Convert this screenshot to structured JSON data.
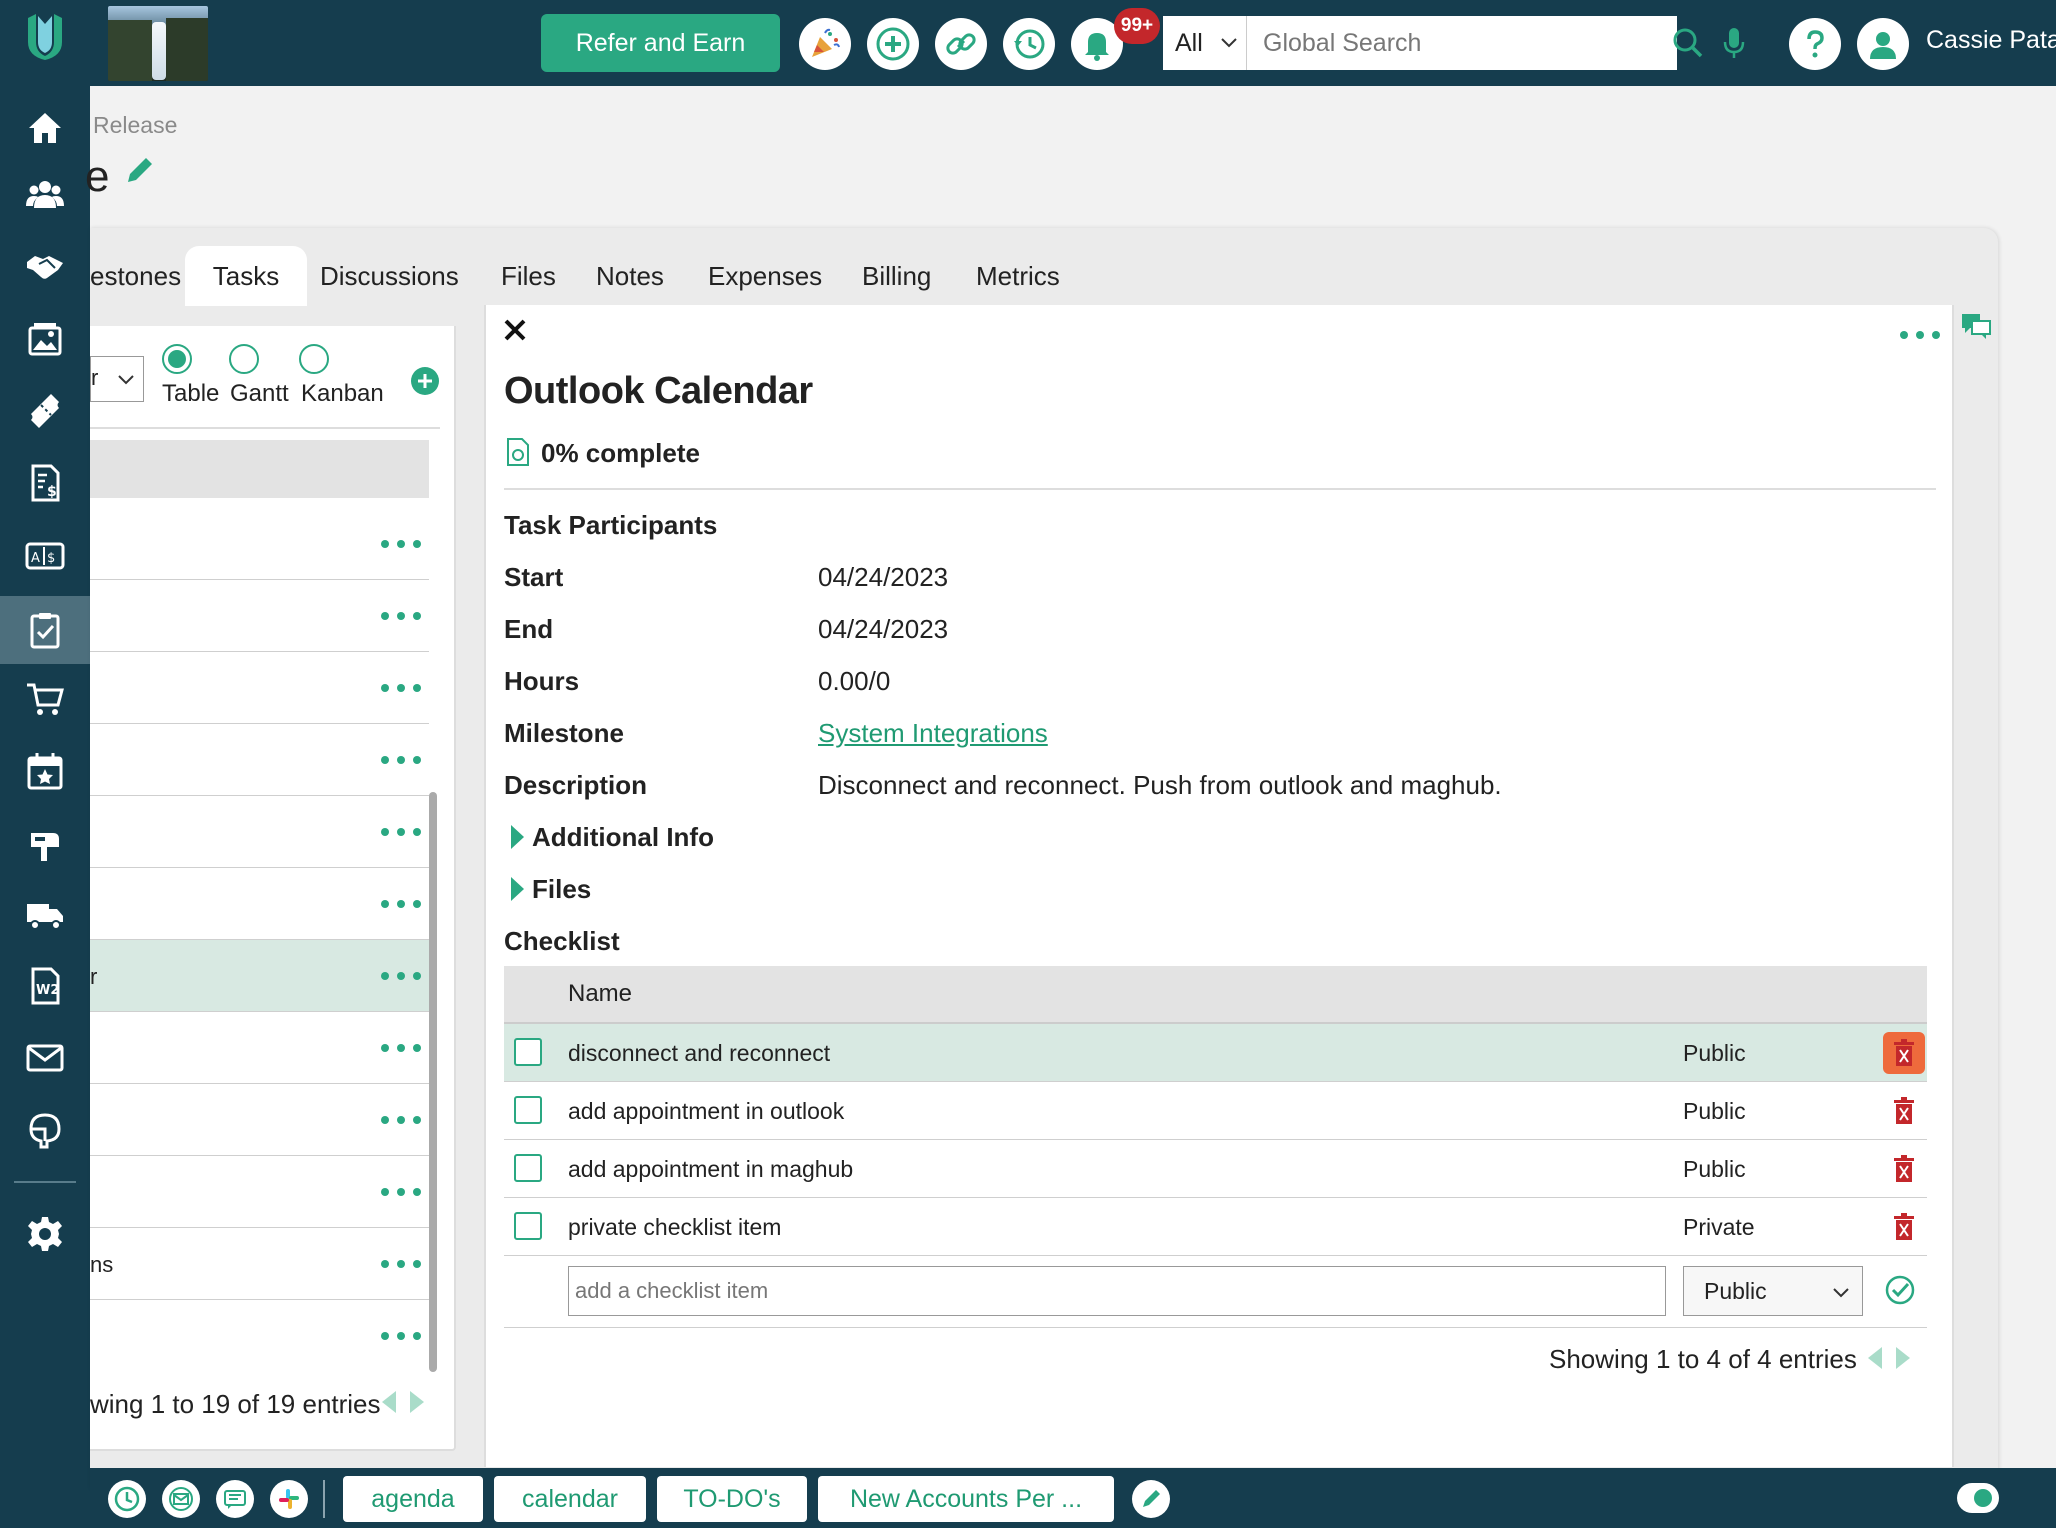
{
  "topbar": {
    "refer_label": "Refer and Earn",
    "notification_count": "99+",
    "search_scope": "All",
    "search_placeholder": "Global Search",
    "user_name": "Cassie Pata"
  },
  "nav": {
    "items": [
      "home-icon",
      "people-icon",
      "handshake-icon",
      "gallery-icon",
      "ticket-icon",
      "invoice-icon",
      "estimates-icon",
      "tasks-icon",
      "cart-icon",
      "calendar-star-icon",
      "mailbox-icon",
      "truck-icon",
      "w2-icon",
      "mail-icon",
      "support-icon",
      "settings-icon"
    ],
    "active": "tasks-icon"
  },
  "page": {
    "breadcrumb": "Release",
    "title": "e"
  },
  "tabs": [
    "estones",
    "Tasks",
    "Discussions",
    "Files",
    "Notes",
    "Expenses",
    "Billing",
    "Metrics"
  ],
  "list": {
    "select_value": "r",
    "views": [
      "Table",
      "Gantt",
      "Kanban"
    ],
    "selected_view": "Table",
    "rows": [
      "",
      "",
      "",
      "",
      "",
      "",
      "r",
      "",
      "",
      "",
      "ns",
      ""
    ],
    "selected_row_index": 6,
    "footer": "wing 1 to 19 of 19 entries"
  },
  "task": {
    "title": "Outlook Calendar",
    "progress": "0% complete",
    "progress_percent": 0,
    "participants_label": "Task Participants",
    "start_label": "Start",
    "start_value": "04/24/2023",
    "end_label": "End",
    "end_value": "04/24/2023",
    "hours_label": "Hours",
    "hours_value": "0.00/0",
    "milestone_label": "Milestone",
    "milestone_value": "System Integrations",
    "description_label": "Description",
    "description_value": "Disconnect and reconnect. Push from outlook and maghub.",
    "additional_info_label": "Additional Info",
    "files_label": "Files",
    "checklist_label": "Checklist"
  },
  "checklist": {
    "column_name": "Name",
    "items": [
      {
        "name": "disconnect and reconnect",
        "visibility": "Public",
        "checked": false
      },
      {
        "name": "add appointment in outlook",
        "visibility": "Public",
        "checked": false
      },
      {
        "name": "add appointment in maghub",
        "visibility": "Public",
        "checked": false
      },
      {
        "name": "private checklist item",
        "visibility": "Private",
        "checked": false
      }
    ],
    "add_placeholder": "add a checklist item",
    "add_visibility": "Public",
    "footer": "Showing 1 to 4 of 4 entries"
  },
  "bottombar": {
    "tabs": [
      "agenda",
      "calendar",
      "TO-DO's",
      "New Accounts Per ..."
    ]
  },
  "colors": {
    "nav_bg": "#153d4e",
    "accent": "#2aa882",
    "link": "#1f9a72",
    "danger": "#c3272b",
    "selected_row": "#d8e9e2"
  }
}
